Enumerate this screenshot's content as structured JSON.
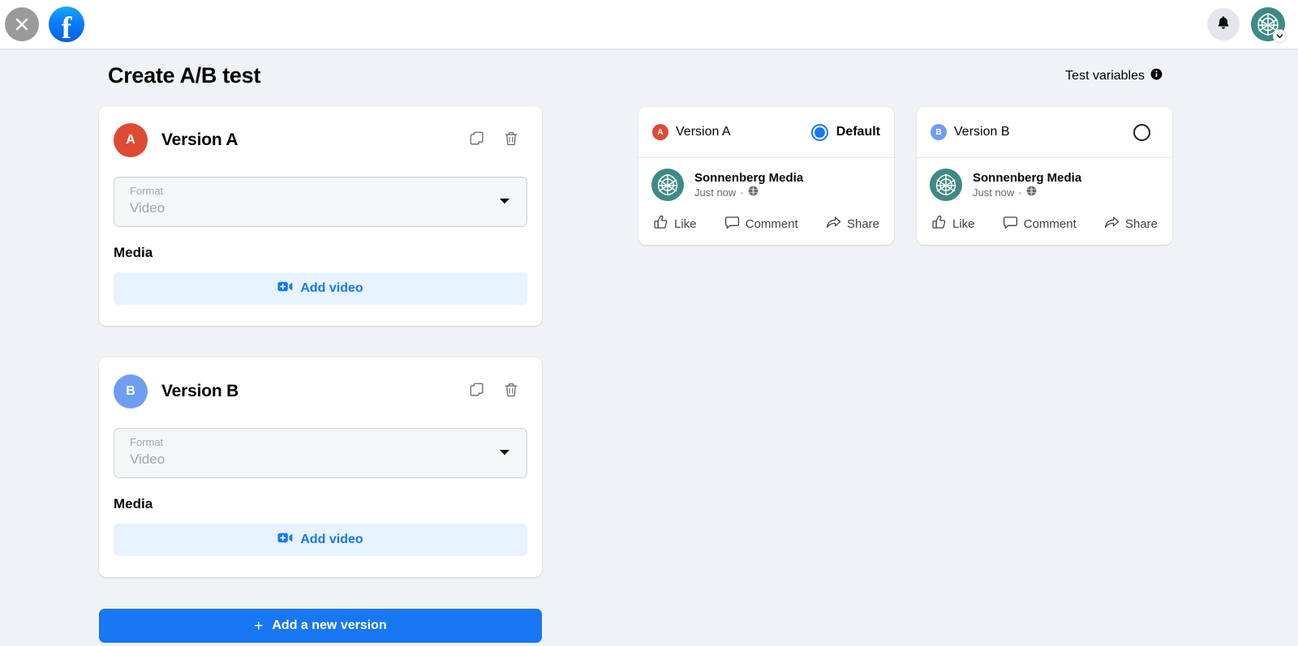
{
  "topbar": {
    "close_icon": "close-icon",
    "brand_icon": "facebook-logo-icon",
    "brand_letter": "f",
    "notifications_icon": "bell-icon",
    "avatar_icon": "account-avatar",
    "avatar_caret_icon": "chevron-down-icon"
  },
  "header": {
    "title": "Create A/B test",
    "test_variables_label": "Test variables",
    "info_icon": "info-icon"
  },
  "colors": {
    "accent_blue": "#1877f2",
    "add_media_bg": "#e7f3ff",
    "version_a": "#dd4b34",
    "version_b": "#6f9ef0",
    "brand_teal": "#3f8a84",
    "page_bg": "#f0f2f5"
  },
  "versions": [
    {
      "badge_letter": "A",
      "badge_color": "#dd4b34",
      "title": "Version A",
      "duplicate_icon": "copy-icon",
      "delete_icon": "trash-icon",
      "format_label": "Format",
      "format_value": "Video",
      "caret_icon": "chevron-down-icon",
      "media_label": "Media",
      "add_media_label": "Add video",
      "add_media_icon": "video-plus-icon"
    },
    {
      "badge_letter": "B",
      "badge_color": "#6f9ef0",
      "title": "Version B",
      "duplicate_icon": "copy-icon",
      "delete_icon": "trash-icon",
      "format_label": "Format",
      "format_value": "Video",
      "caret_icon": "chevron-down-icon",
      "media_label": "Media",
      "add_media_label": "Add video",
      "add_media_icon": "video-plus-icon"
    }
  ],
  "add_version": {
    "label": "Add a new version",
    "plus": "+"
  },
  "previews": [
    {
      "badge_letter": "A",
      "badge_color": "#dd4b34",
      "version_label": "Version A",
      "is_default": true,
      "default_label": "Default",
      "page_name": "Sonnenberg Media",
      "timestamp": "Just now",
      "separator": "·",
      "privacy_icon": "globe-icon",
      "actions": [
        {
          "label": "Like",
          "icon": "thumbs-up-icon"
        },
        {
          "label": "Comment",
          "icon": "comment-bubble-icon"
        },
        {
          "label": "Share",
          "icon": "share-arrow-icon"
        }
      ]
    },
    {
      "badge_letter": "B",
      "badge_color": "#6f9ef0",
      "version_label": "Version B",
      "is_default": false,
      "default_label": "",
      "page_name": "Sonnenberg Media",
      "timestamp": "Just now",
      "separator": "·",
      "privacy_icon": "globe-icon",
      "actions": [
        {
          "label": "Like",
          "icon": "thumbs-up-icon"
        },
        {
          "label": "Comment",
          "icon": "comment-bubble-icon"
        },
        {
          "label": "Share",
          "icon": "share-arrow-icon"
        }
      ]
    }
  ]
}
